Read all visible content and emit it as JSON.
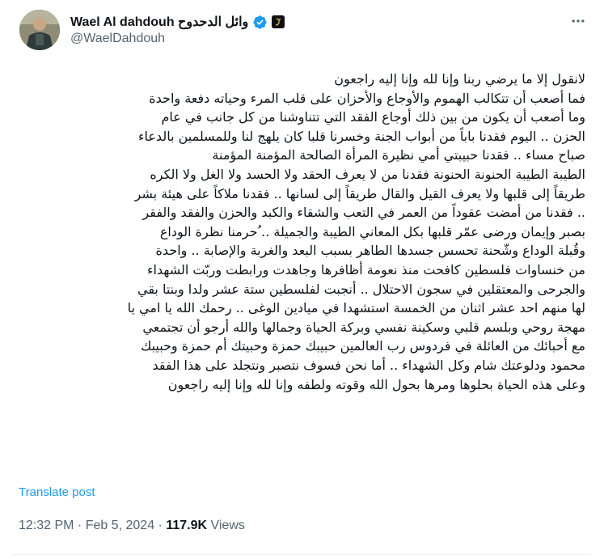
{
  "author": {
    "display_name": "Wael Al dahdouh وائل الدحدوح",
    "handle": "@WaelDahdouh",
    "verified": true,
    "avatar_icon": "person-photo-icon",
    "affiliation_badge_icon": "al-jazeera-badge-icon"
  },
  "more_icon": "more-horizontal-icon",
  "tweet": {
    "lines": [
      "لانقول إلا ما يرضي ربنا وإنا لله وإنا إليه راجعون",
      "فما أصعب أن تتكالب الهموم والأوجاع والأحزان على قلب المرء وحياته دفعة واحدة",
      "وما أصعب أن يكون من بين ذلك أوجاع الفقد التي تتناوشنا من كل جانب في عام",
      "الحزن .. اليوم فقدنا باباً من أبواب الجنة وخسرنا قلبا كان يلهج لنا وللمسلمين بالدعاء",
      "صباح مساء .. فقدنا حبيبتي أمي نظيرة المرأة الصالحة المؤمنة المؤمنة",
      "الطيبة الطيبة الحنونة الحنونة فقدنا من لا يعرف الحقد ولا الحسد ولا الغل ولا الكره",
      "طريقاً إلى قلبها ولا يعرف القيل والقال طريقاً إلى لسانها .. فقدنا ملاكاً على هيئة بشر",
      ".. فقدنا من أمضت عقوداً من العمر في التعب والشقاء والكبد والحزن والفقد والفقر",
      "بصبر وإيمان ورضى عمّر قلبها بكل المعاني الطيبة والجميلة .. ُحرمنا نظرة الوداع",
      "وقُبلة الوداع وشّحنة تحسس جسدها الطاهر بسبب البعد والغربة والإصابة .. واحدة",
      "من خنساوات فلسطين كافحت منذ نعومة أظافرها وجاهدت ورابطت وربّت الشهداء",
      "والجرحى والمعتقلين في سجون الاحتلال .. أنجبت لفلسطين ستة عشر ولدا وبنتا بقي",
      "لها منهم احد عشر اثنان من الخمسة استشهدا في ميادين الوغى .. رحمك الله يا امي يا",
      "مهجة روحي وبلسم قلبي وسكينة نفسي وبركة الحياة وجمالها والله أرجو أن تجتمعي",
      "مع أحبائك من العائلة في فردوس رب العالمين حبيبك حمزة وحبيتك أم حمزة وحبيبك",
      "محمود ودلوعتك شام وكل الشهداء .. أما نحن فسوف نتصبر ونتجلد على هذا الفقد",
      "وعلى هذه الحياة بحلوها ومرها بحول الله وقوته ولطفه وإنا لله وإنا إليه راجعون"
    ]
  },
  "translate_label": "Translate post",
  "meta": {
    "time": "12:32 PM",
    "separator": " · ",
    "date": "Feb 5, 2024",
    "separator2": " · ",
    "views_count": "117.9K",
    "views_label": " Views"
  },
  "colors": {
    "text": "#0f1419",
    "secondary": "#536471",
    "accent": "#1d9bf0"
  }
}
